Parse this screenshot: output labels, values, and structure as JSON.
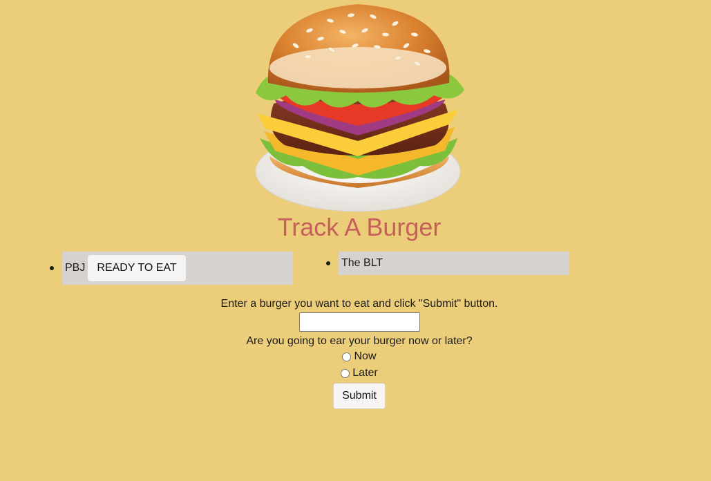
{
  "page": {
    "title": "Track A Burger"
  },
  "burgers": {
    "not_devoured": [
      {
        "name": "PBJ",
        "button_label": "READY TO EAT"
      }
    ],
    "devoured": [
      {
        "name": "The BLT"
      }
    ]
  },
  "form": {
    "prompt": "Enter a burger you want to eat and click \"Submit\" button.",
    "input_value": "",
    "question": "Are you going to ear your burger now or later?",
    "options": [
      {
        "label": "Now",
        "checked": false
      },
      {
        "label": "Later",
        "checked": false
      }
    ],
    "submit_label": "Submit"
  },
  "colors": {
    "background": "#ecce7a",
    "title": "#c6605b",
    "item_background": "#d6d2d0"
  },
  "icons": {
    "hero": "burger-illustration"
  }
}
